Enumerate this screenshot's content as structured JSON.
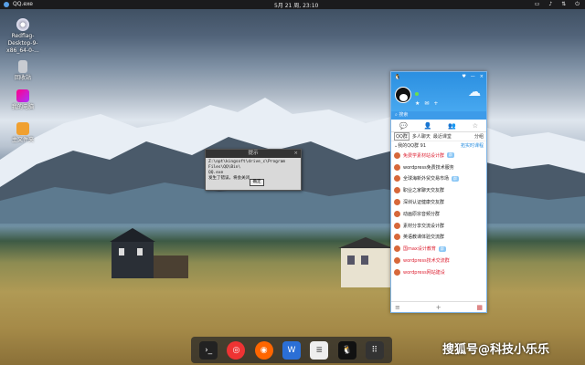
{
  "topbar": {
    "app_name": "QQ.exe",
    "clock": "5月 21 周, 23:10",
    "tray_icons": [
      "monitor-icon",
      "volume-icon",
      "network-icon",
      "power-icon"
    ]
  },
  "desktop": {
    "icons": [
      {
        "label": "Redflag-\nDesktop-9-\nx86_64-0-...",
        "icon": "disc-icon"
      },
      {
        "label": "回收站",
        "icon": "trash-icon"
      },
      {
        "label": "我的电脑",
        "icon": "computer-icon"
      },
      {
        "label": "主文件夹",
        "icon": "folder-icon"
      }
    ]
  },
  "dialog": {
    "title": "提示",
    "message_line1": "Z:\\opt\\kingsoft\\drive_c\\Program Files\\QQ\\Bin\\",
    "message_line2": "QQ.exe",
    "message_line3": "发生了错误，将会关闭",
    "ok_label": "确定"
  },
  "qq": {
    "search_placeholder": "搜索",
    "subtabs": [
      "QQ群",
      "多人聊天",
      "最近课堂",
      "分组"
    ],
    "group_header": "我的QQ群 91",
    "group_tag": "拓实时课程",
    "groups": [
      {
        "name": "免费学素材站设计群",
        "red": true,
        "badge": "群"
      },
      {
        "name": "wordpress免费技术服务",
        "red": false,
        "badge": ""
      },
      {
        "name": "全球海新外贸交易市场",
        "red": false,
        "badge": "群"
      },
      {
        "name": "职业之家聊天交友群",
        "red": false,
        "badge": ""
      },
      {
        "name": "深圳认证健康交友群",
        "red": false,
        "badge": ""
      },
      {
        "name": "动画原宗音频分群",
        "red": false,
        "badge": ""
      },
      {
        "name": "素材分享交流设计群",
        "red": false,
        "badge": ""
      },
      {
        "name": "英语教课体验交流群",
        "red": false,
        "badge": ""
      },
      {
        "name": "国max设计教育",
        "red": true,
        "badge": "群"
      },
      {
        "name": "wordpress技术交流群",
        "red": true,
        "badge": ""
      },
      {
        "name": "wordpress网站建设",
        "red": true,
        "badge": ""
      }
    ]
  },
  "dock": {
    "apps": [
      "terminal-icon",
      "netease-music-icon",
      "firefox-icon",
      "wps-icon",
      "text-editor-icon",
      "qq-icon",
      "app-grid-icon"
    ]
  },
  "watermark": "搜狐号@科技小乐乐"
}
